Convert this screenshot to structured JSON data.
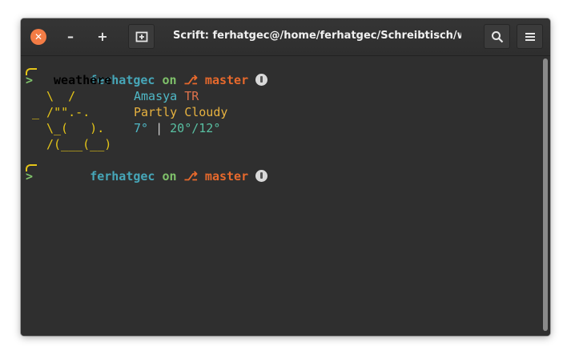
{
  "window": {
    "title": "Scrift: ferhatgec@/home/ferhatgec/Schreibtisch/weathere",
    "close_glyph": "✕",
    "minimize_glyph": "–",
    "maximize_glyph": "+"
  },
  "toolbar": {
    "new_tab_icon": "new-tab-icon",
    "search_icon": "search-icon",
    "menu_icon": "hamburger-menu-icon"
  },
  "prompt": {
    "user": "ferhatgec",
    "on": "on",
    "branch_glyph": "⎇",
    "branch": "master",
    "arrow": ">"
  },
  "command": " weathere",
  "weather": {
    "art": [
      "\\  /",
      "_ /\"\".-.",
      "\\_(   ).",
      "/(___(__)"
    ],
    "city": "Amasya",
    "country": "TR",
    "condition": "Partly Cloudy",
    "temp_current": "7°",
    "separator": "|",
    "temp_range": "20°/12°"
  },
  "colors": {
    "user": "#46a6b8",
    "on": "#7fc16a",
    "branch": "#e7692c",
    "art": "#e5c518",
    "close": "#f37c45"
  }
}
